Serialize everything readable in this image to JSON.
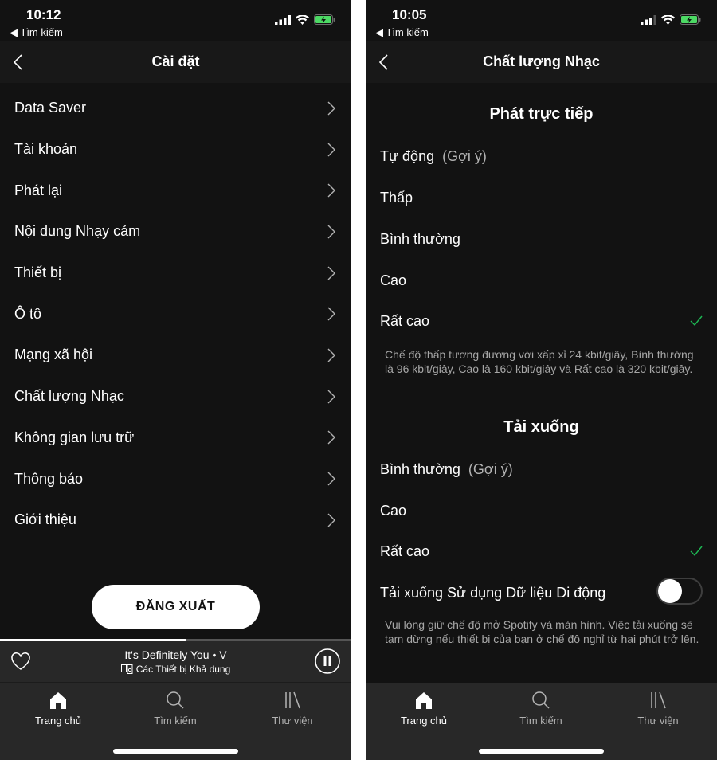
{
  "left_screen": {
    "status": {
      "time": "10:12",
      "back_app": "◀ Tìm kiếm"
    },
    "nav": {
      "title": "Cài đặt"
    },
    "menu": [
      {
        "label": "Data Saver"
      },
      {
        "label": "Tài khoản"
      },
      {
        "label": "Phát lại"
      },
      {
        "label": "Nội dung Nhạy cảm"
      },
      {
        "label": "Thiết bị"
      },
      {
        "label": "Ô tô"
      },
      {
        "label": "Mạng xã hội"
      },
      {
        "label": "Chất lượng Nhạc"
      },
      {
        "label": "Không gian lưu trữ"
      },
      {
        "label": "Thông báo"
      },
      {
        "label": "Giới thiệu"
      }
    ],
    "logout_label": "ĐĂNG XUẤT",
    "player": {
      "track": "It's Definitely You • V",
      "device": "Các Thiết bị Khả dụng",
      "progress_percent": 53
    },
    "tabs": [
      {
        "label": "Trang chủ",
        "icon": "home-icon",
        "active": true
      },
      {
        "label": "Tìm kiếm",
        "icon": "search-icon",
        "active": false
      },
      {
        "label": "Thư viện",
        "icon": "library-icon",
        "active": false
      }
    ]
  },
  "right_screen": {
    "status": {
      "time": "10:05",
      "back_app": "◀ Tìm kiếm"
    },
    "nav": {
      "title": "Chất lượng Nhạc"
    },
    "streaming": {
      "heading": "Phát trực tiếp",
      "options": [
        {
          "label": "Tự động",
          "hint": "(Gợi ý)",
          "selected": false
        },
        {
          "label": "Thấp",
          "hint": "",
          "selected": false
        },
        {
          "label": "Bình thường",
          "hint": "",
          "selected": false
        },
        {
          "label": "Cao",
          "hint": "",
          "selected": false
        },
        {
          "label": "Rất cao",
          "hint": "",
          "selected": true
        }
      ],
      "note": "Chế độ thấp tương đương với xấp xỉ 24 kbit/giây, Bình thường là 96 kbit/giây, Cao là 160 kbit/giây và Rất cao là 320 kbit/giây."
    },
    "download": {
      "heading": "Tải xuống",
      "options": [
        {
          "label": "Bình thường",
          "hint": "(Gợi ý)",
          "selected": false
        },
        {
          "label": "Cao",
          "hint": "",
          "selected": false
        },
        {
          "label": "Rất cao",
          "hint": "",
          "selected": true
        }
      ],
      "cellular_label": "Tải xuống Sử dụng Dữ liệu Di động",
      "cellular_enabled": false,
      "note": "Vui lòng giữ chế độ mở Spotify và màn hình. Việc tải xuống sẽ tạm dừng nếu thiết bị của bạn ở chế độ nghỉ từ hai phút trở lên."
    },
    "tabs": [
      {
        "label": "Trang chủ",
        "icon": "home-icon",
        "active": true
      },
      {
        "label": "Tìm kiếm",
        "icon": "search-icon",
        "active": false
      },
      {
        "label": "Thư viện",
        "icon": "library-icon",
        "active": false
      }
    ]
  },
  "colors": {
    "accent": "#1db954",
    "background": "#121212",
    "bar": "#282828",
    "battery": "#4cd964"
  }
}
